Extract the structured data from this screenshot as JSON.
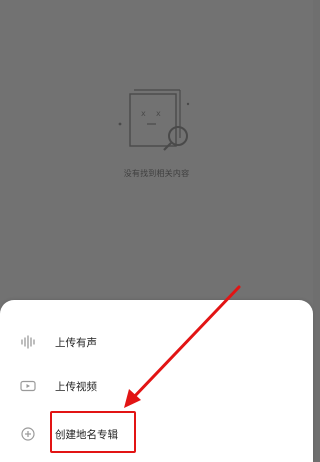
{
  "empty_state": {
    "message": "没有找到相关内容",
    "icon": "empty-box-search-icon"
  },
  "sheet": {
    "items": [
      {
        "label": "上传有声",
        "icon": "audio-wave-icon"
      },
      {
        "label": "上传视频",
        "icon": "video-camera-icon"
      },
      {
        "label": "创建地名专辑",
        "icon": "plus-circle-icon"
      }
    ]
  },
  "annotation": {
    "highlight_color": "#e21414"
  }
}
